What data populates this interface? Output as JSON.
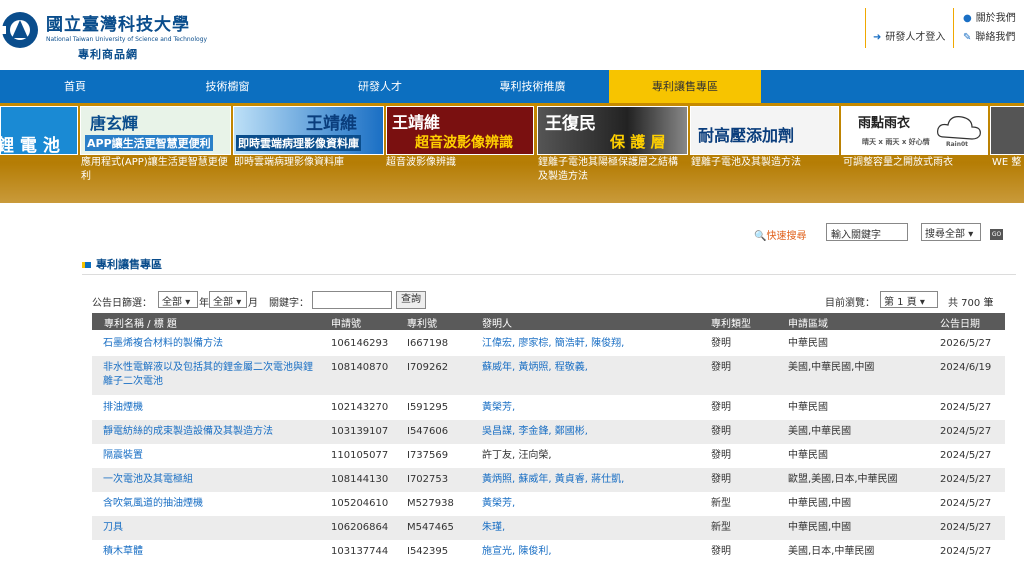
{
  "header": {
    "brand_cn": "國立臺灣科技大學",
    "brand_en": "National Taiwan University of Science and Technology",
    "site_name": "專利商品網",
    "links": {
      "about": "關於我們",
      "talent_login": "研發人才登入",
      "contact": "聯絡我們"
    }
  },
  "nav": [
    {
      "label": "首頁"
    },
    {
      "label": "技術櫥窗"
    },
    {
      "label": "研發人才"
    },
    {
      "label": "專利技術推廣"
    },
    {
      "label": "專利讓售專區"
    }
  ],
  "banner": [
    {
      "thumb": "鋰 電 池",
      "caption": ""
    },
    {
      "thumb": "唐玄輝",
      "thumb2": "APP讓生活更智慧更便利",
      "caption": "應用程式(APP)讓生活更智慧更便利"
    },
    {
      "thumb": "王靖維",
      "thumb2": "即時雲端病理影像資料庫",
      "caption": "即時雲端病理影像資料庫"
    },
    {
      "thumb": "王靖維",
      "thumb2": "超音波影像辨識",
      "caption": "超音波影像辨識"
    },
    {
      "thumb": "王復民",
      "thumb2": "保 護 層",
      "caption": "鋰離子電池其陽極保護層之結構及製造方法"
    },
    {
      "thumb": "耐高壓添加劑",
      "caption": "鋰離子電池及其製造方法"
    },
    {
      "thumb": "雨點雨衣",
      "thumb2": "晴天 x 雨天 x 好心情",
      "thumb3": "Rain0t",
      "caption": "可調整容量之開放式雨衣"
    },
    {
      "thumb": "",
      "caption": "WE 整"
    }
  ],
  "quick_search": {
    "label": "快速搜尋",
    "keyword": "輸入關鍵字",
    "scope": "搜尋全部",
    "go": "GO"
  },
  "section_title": "專利讓售專區",
  "filter": {
    "date_label": "公告日篩選：",
    "year_value": "全部",
    "year_unit": "年",
    "month_value": "全部",
    "month_unit": "月",
    "keyword_label": "關鍵字：",
    "query_button": "查詢",
    "browse_label": "目前瀏覽：",
    "page_value": "第 1 頁",
    "total": "共 700 筆"
  },
  "table": {
    "headers": [
      "專利名稱 / 標 題",
      "申請號",
      "專利號",
      "發明人",
      "專利類型",
      "申請區域",
      "公告日期"
    ],
    "rows": [
      {
        "title": "石墨烯複合材料的製備方法",
        "app": "106146293",
        "pat": "I667198",
        "inv": "江偉宏, 廖家棕, 簡浩軒, 陳俊翔,",
        "type": "發明",
        "region": "中華民國",
        "date": "2026/5/27"
      },
      {
        "title": "非水性電解液以及包括其的鋰金屬二次電池與鋰離子二次電池",
        "app": "108140870",
        "pat": "I709262",
        "inv": "蘇威年, 黃炳照, 程敬義,",
        "type": "發明",
        "region": "美國,中華民國,中國",
        "date": "2024/6/19"
      },
      {
        "title": "排油煙機",
        "app": "102143270",
        "pat": "I591295",
        "inv": "黃榮芳,",
        "type": "發明",
        "region": "中華民國",
        "date": "2024/5/27"
      },
      {
        "title": "靜電紡絲的成束製造設備及其製造方法",
        "app": "103139107",
        "pat": "I547606",
        "inv": "吳昌謀, 李金鋒, 鄭國彬,",
        "type": "發明",
        "region": "美國,中華民國",
        "date": "2024/5/27"
      },
      {
        "title": "隔震裝置",
        "app": "110105077",
        "pat": "I737569",
        "inv": "許丁友, 汪向榮,",
        "type": "發明",
        "region": "中華民國",
        "date": "2024/5/27"
      },
      {
        "title": "一次電池及其電極組",
        "app": "108144130",
        "pat": "I702753",
        "inv": "黃炳照, 蘇威年, 黃貞睿, 蔣仕凱,",
        "type": "發明",
        "region": "歐盟,美國,日本,中華民國",
        "date": "2024/5/27"
      },
      {
        "title": "含吹氣風道的抽油煙機",
        "app": "105204610",
        "pat": "M527938",
        "inv": "黃榮芳,",
        "type": "新型",
        "region": "中華民國,中國",
        "date": "2024/5/27"
      },
      {
        "title": "刀具",
        "app": "106206864",
        "pat": "M547465",
        "inv": "朱瑾,",
        "type": "新型",
        "region": "中華民國,中國",
        "date": "2024/5/27"
      },
      {
        "title": "積木草體",
        "app": "103137744",
        "pat": "I542395",
        "inv": "施宣光, 陳俊利,",
        "type": "發明",
        "region": "美國,日本,中華民國",
        "date": "2024/5/27"
      }
    ]
  }
}
